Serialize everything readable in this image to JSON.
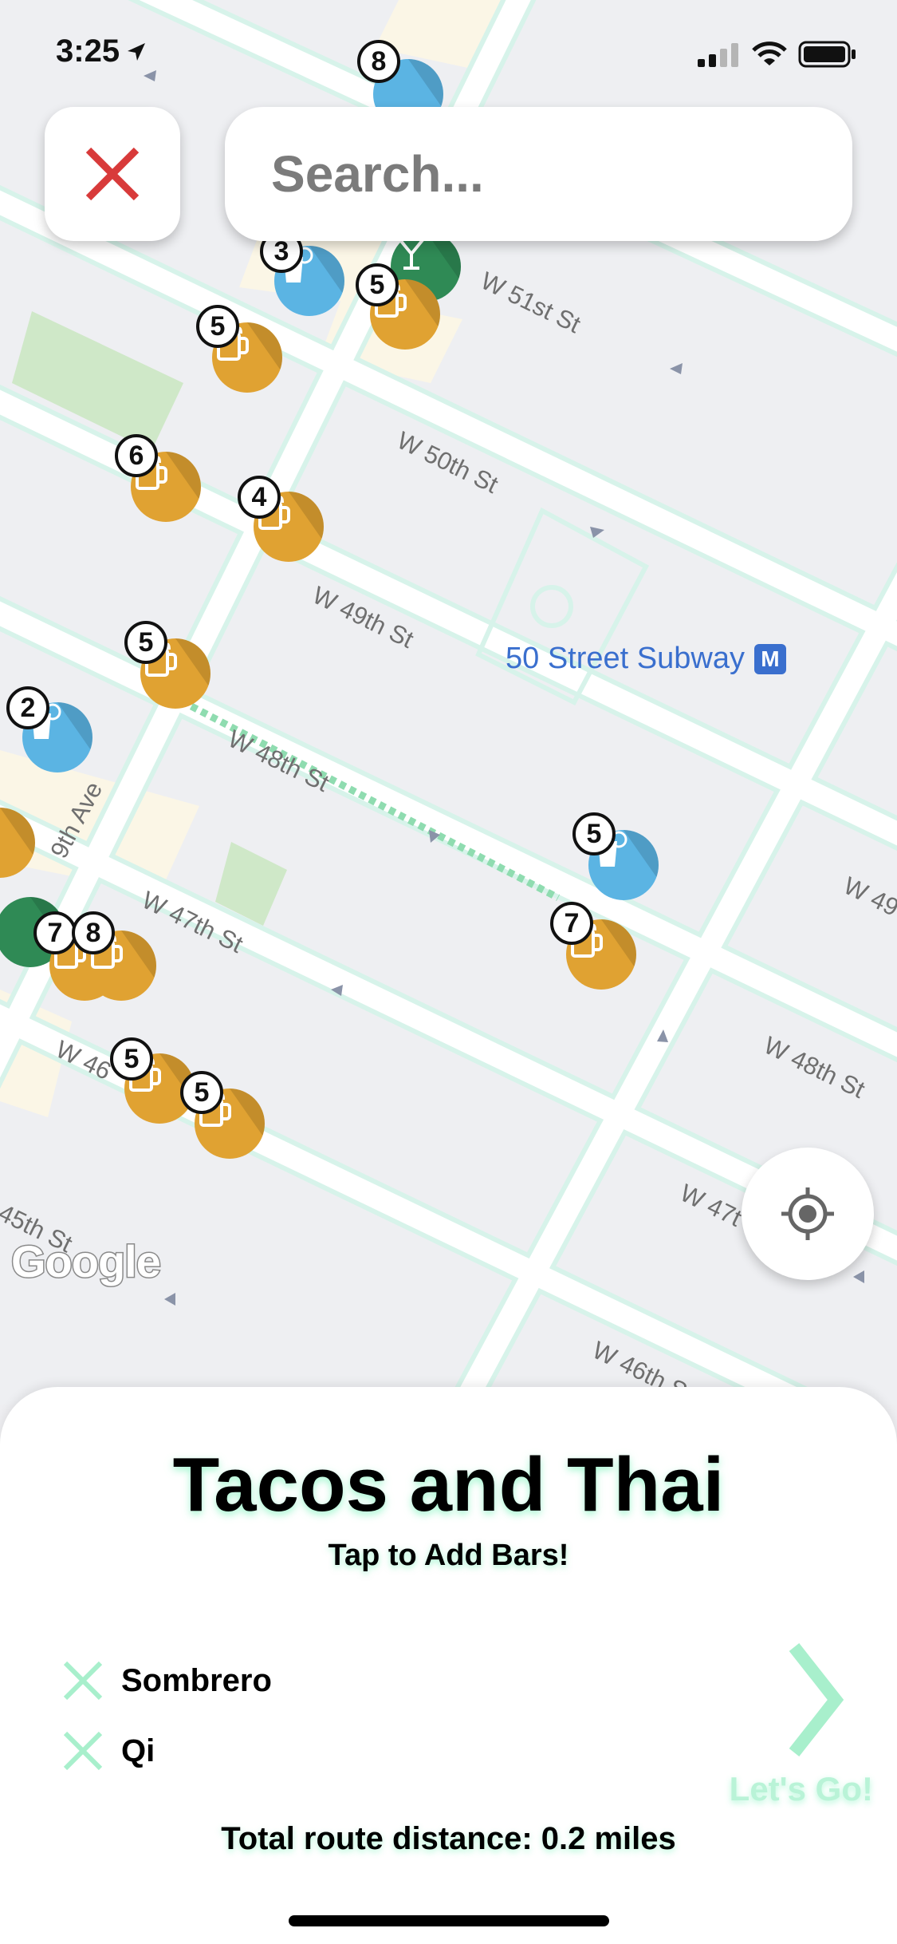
{
  "status_bar": {
    "time": "3:25"
  },
  "search": {
    "placeholder": "Search..."
  },
  "map": {
    "streets": [
      "W 51st St",
      "W 50th St",
      "W 49th St",
      "W 48th St",
      "W 47th St",
      "9th Ave",
      "W 48th St",
      "W 49",
      "W 47t",
      "W 46th St",
      "W 46",
      "45th St"
    ],
    "subway_label": "50 Street Subway",
    "subway_badge": "M",
    "attribution": "Google",
    "markers": [
      {
        "type": "cocktail",
        "count": "8"
      },
      {
        "type": "cocktail",
        "count": "3"
      },
      {
        "type": "beer",
        "count": "5"
      },
      {
        "type": "beer",
        "count": "5"
      },
      {
        "type": "beer",
        "count": "6"
      },
      {
        "type": "beer",
        "count": "4"
      },
      {
        "type": "beer",
        "count": "5"
      },
      {
        "type": "cocktail",
        "count": "2"
      },
      {
        "type": "cocktail",
        "count": "5"
      },
      {
        "type": "beer",
        "count": "7"
      },
      {
        "type": "beer",
        "count": "7"
      },
      {
        "type": "beer",
        "count": "8"
      },
      {
        "type": "beer",
        "count": "5"
      },
      {
        "type": "beer",
        "count": "5"
      }
    ]
  },
  "sheet": {
    "title": "Tacos and Thai",
    "subtitle": "Tap to Add Bars!",
    "bars": [
      {
        "name": "Sombrero"
      },
      {
        "name": "Qi"
      }
    ],
    "go_label": "Let's Go!",
    "distance": "Total route distance: 0.2 miles"
  },
  "colors": {
    "accent_green": "#a8efcc",
    "close_red": "#d83a3a",
    "beer": "#e0a232",
    "cocktail": "#5bb4e3",
    "martini": "#2f8a55"
  },
  "icons": {
    "close": "close-icon",
    "locate": "crosshair-icon",
    "remove": "x-icon",
    "go": "chevron-right-icon"
  }
}
